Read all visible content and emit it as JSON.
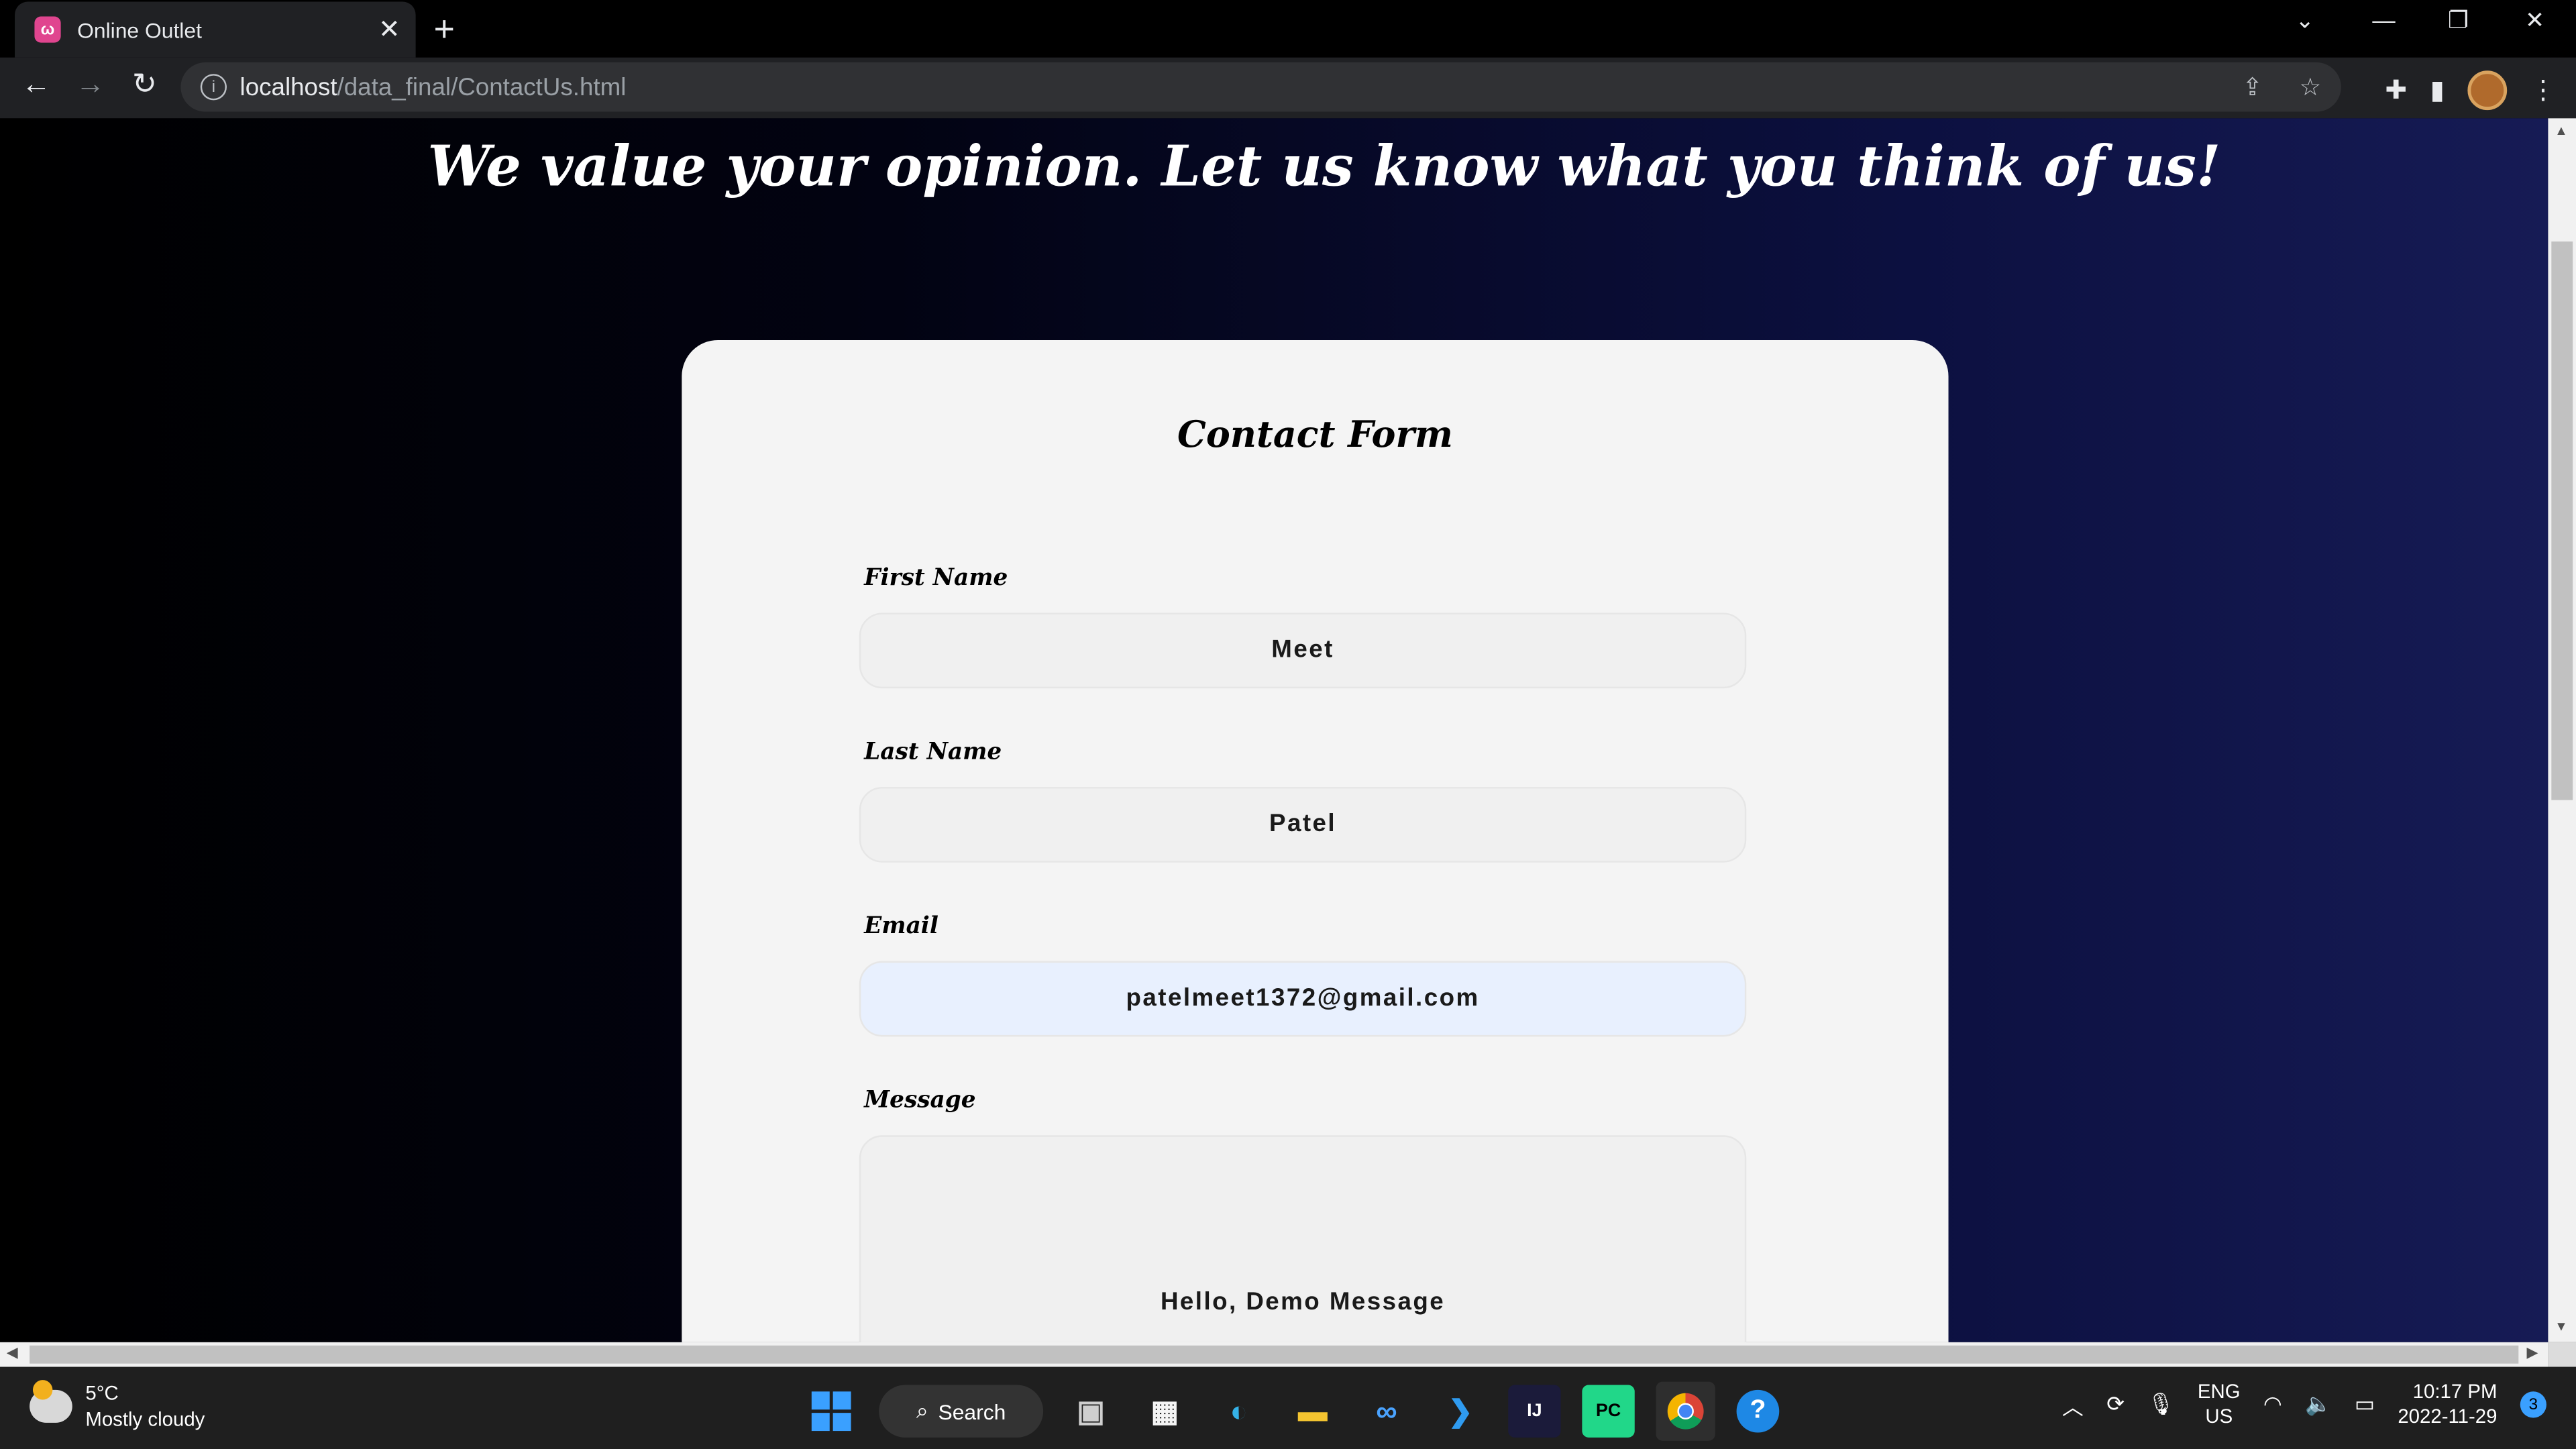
{
  "browser": {
    "tab_title": "Online Outlet",
    "tab_close": "✕",
    "new_tab": "+",
    "url_host": "localhost",
    "url_path": "/data_final/ContactUs.html"
  },
  "page": {
    "headline": "We value your opinion. Let us know what you think of us!",
    "form": {
      "title": "Contact Form",
      "first_name_label": "First Name",
      "first_name_value": "Meet",
      "last_name_label": "Last Name",
      "last_name_value": "Patel",
      "email_label": "Email",
      "email_value": "patelmeet1372@gmail.com",
      "message_label": "Message",
      "message_value": "Hello, Demo Message"
    }
  },
  "taskbar": {
    "weather_temp": "5°C",
    "weather_desc": "Mostly cloudy",
    "search_label": "Search",
    "lang_primary": "ENG",
    "lang_secondary": "US",
    "time": "10:17 PM",
    "date": "2022-11-29",
    "notification_count": "3"
  },
  "colors": {
    "card_bg": "#f4f4f4",
    "autofill_bg": "#e8f0fe",
    "gradient_end": "#161b55"
  }
}
